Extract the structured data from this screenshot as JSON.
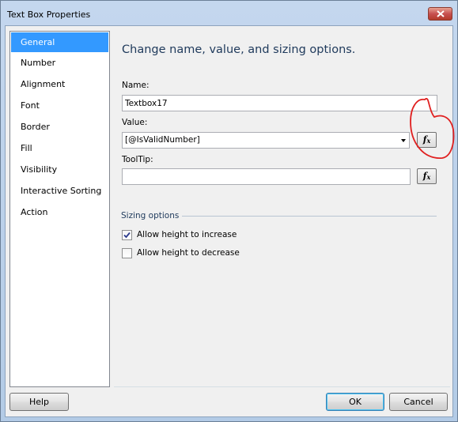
{
  "window": {
    "title": "Text Box Properties"
  },
  "nav": {
    "items": [
      {
        "label": "General",
        "selected": true
      },
      {
        "label": "Number"
      },
      {
        "label": "Alignment"
      },
      {
        "label": "Font"
      },
      {
        "label": "Border"
      },
      {
        "label": "Fill"
      },
      {
        "label": "Visibility"
      },
      {
        "label": "Interactive Sorting"
      },
      {
        "label": "Action"
      }
    ]
  },
  "main": {
    "heading": "Change name, value, and sizing options.",
    "name_label": "Name:",
    "name_value": "Textbox17",
    "value_label": "Value:",
    "value_value": "[@IsValidNumber]",
    "tooltip_label": "ToolTip:",
    "tooltip_value": "",
    "fx_label": "fx",
    "sizing_label": "Sizing options",
    "allow_increase_label": "Allow height to increase",
    "allow_increase_checked": true,
    "allow_decrease_label": "Allow height to decrease",
    "allow_decrease_checked": false
  },
  "footer": {
    "help": "Help",
    "ok": "OK",
    "cancel": "Cancel"
  },
  "colors": {
    "selection": "#3399ff",
    "heading": "#1e395b",
    "annotation": "#e02020"
  }
}
